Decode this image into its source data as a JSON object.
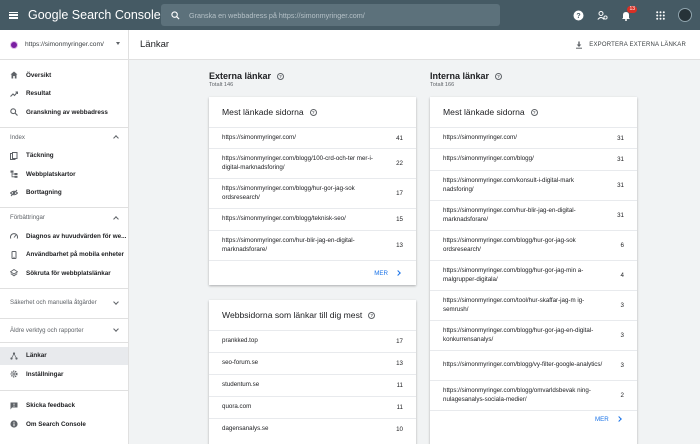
{
  "app": {
    "logo_text": "Google Search Console",
    "search_placeholder": "Granska en webbadress på https://simonmyringer.com/",
    "notification_count": "13"
  },
  "sidebar": {
    "property": "https://simonmyringer.com/",
    "items_top": [
      {
        "label": "Översikt",
        "icon": "home-icon"
      },
      {
        "label": "Resultat",
        "icon": "trending-up-icon"
      },
      {
        "label": "Granskning av webbadress",
        "icon": "search-icon"
      }
    ],
    "section_index": "Index",
    "items_index": [
      {
        "label": "Täckning",
        "icon": "file-copy-icon"
      },
      {
        "label": "Webbplatskartor",
        "icon": "sitemap-icon"
      },
      {
        "label": "Borttagning",
        "icon": "visibility-off-icon"
      }
    ],
    "section_enhancements": "Förbättringar",
    "items_enhancements": [
      {
        "label": "Diagnos av huvudvärden för we...",
        "icon": "speed-icon"
      },
      {
        "label": "Användbarhet på mobila enheter",
        "icon": "smartphone-icon"
      },
      {
        "label": "Sökruta för webbplatslänkar",
        "icon": "layers-icon"
      }
    ],
    "section_security": "Säkerhet och manuella åtgärder",
    "section_legacy": "Äldre verktyg och rapporter",
    "items_bottom": [
      {
        "label": "Länkar",
        "icon": "link-network-icon",
        "active": true
      },
      {
        "label": "Inställningar",
        "icon": "settings-icon"
      }
    ],
    "items_footer": [
      {
        "label": "Skicka feedback",
        "icon": "feedback-icon"
      },
      {
        "label": "Om Search Console",
        "icon": "info-icon"
      }
    ]
  },
  "header": {
    "title": "Länkar",
    "export_label": "EXPORTERA EXTERNA LÄNKAR"
  },
  "external": {
    "title": "Externa länkar",
    "total": "Totalt 146",
    "top_pages": {
      "title": "Mest länkade sidorna",
      "rows": [
        {
          "url": "https://simonmyringer.com/",
          "count": "41"
        },
        {
          "url": "https://simonmyringer.com/blogg/100-crd-och-ter mer-i-digital-marknadsforing/",
          "count": "22"
        },
        {
          "url": "https://simonmyringer.com/blogg/hur-gor-jag-sok ordsresearch/",
          "count": "17"
        },
        {
          "url": "https://simonmyringer.com/blogg/teknisk-seo/",
          "count": "15"
        },
        {
          "url": "https://simonmyringer.com/hur-blir-jag-en-digital-marknadsforare/",
          "count": "13"
        }
      ],
      "more": "MER"
    },
    "top_sites": {
      "title": "Webbsidorna som länkar till dig mest",
      "rows": [
        {
          "url": "prankked.top",
          "count": "17"
        },
        {
          "url": "seo-forum.se",
          "count": "13"
        },
        {
          "url": "studentum.se",
          "count": "11"
        },
        {
          "url": "quora.com",
          "count": "11"
        },
        {
          "url": "dagensanalys.se",
          "count": "10"
        }
      ]
    }
  },
  "internal": {
    "title": "Interna länkar",
    "total": "Totalt 166",
    "top_pages": {
      "title": "Mest länkade sidorna",
      "rows": [
        {
          "url": "https://simonmyringer.com/",
          "count": "31"
        },
        {
          "url": "https://simonmyringer.com/blogg/",
          "count": "31"
        },
        {
          "url": "https://simonmyringer.com/konsult-i-digital-mark nadsforing/",
          "count": "31"
        },
        {
          "url": "https://simonmyringer.com/hur-blir-jag-en-digital-marknadsforare/",
          "count": "31"
        },
        {
          "url": "https://simonmyringer.com/blogg/hur-gor-jag-sok ordsresearch/",
          "count": "6"
        },
        {
          "url": "https://simonmyringer.com/blogg/hur-gor-jag-min a-malgrupper-digitala/",
          "count": "4"
        },
        {
          "url": "https://simonmyringer.com/tool/hur-skaffar-jag-m ig-semrush/",
          "count": "3"
        },
        {
          "url": "https://simonmyringer.com/blogg/hur-gor-jag-en-digital-konkurrensanalys/",
          "count": "3"
        },
        {
          "url": "https://simonmyringer.com/blogg/vy-filter-google-analytics/",
          "count": "3"
        },
        {
          "url": "https://simonmyringer.com/blogg/omvarldsbevak ning-nulagesanalys-sociala-medier/",
          "count": "2"
        }
      ],
      "more": "MER"
    }
  }
}
